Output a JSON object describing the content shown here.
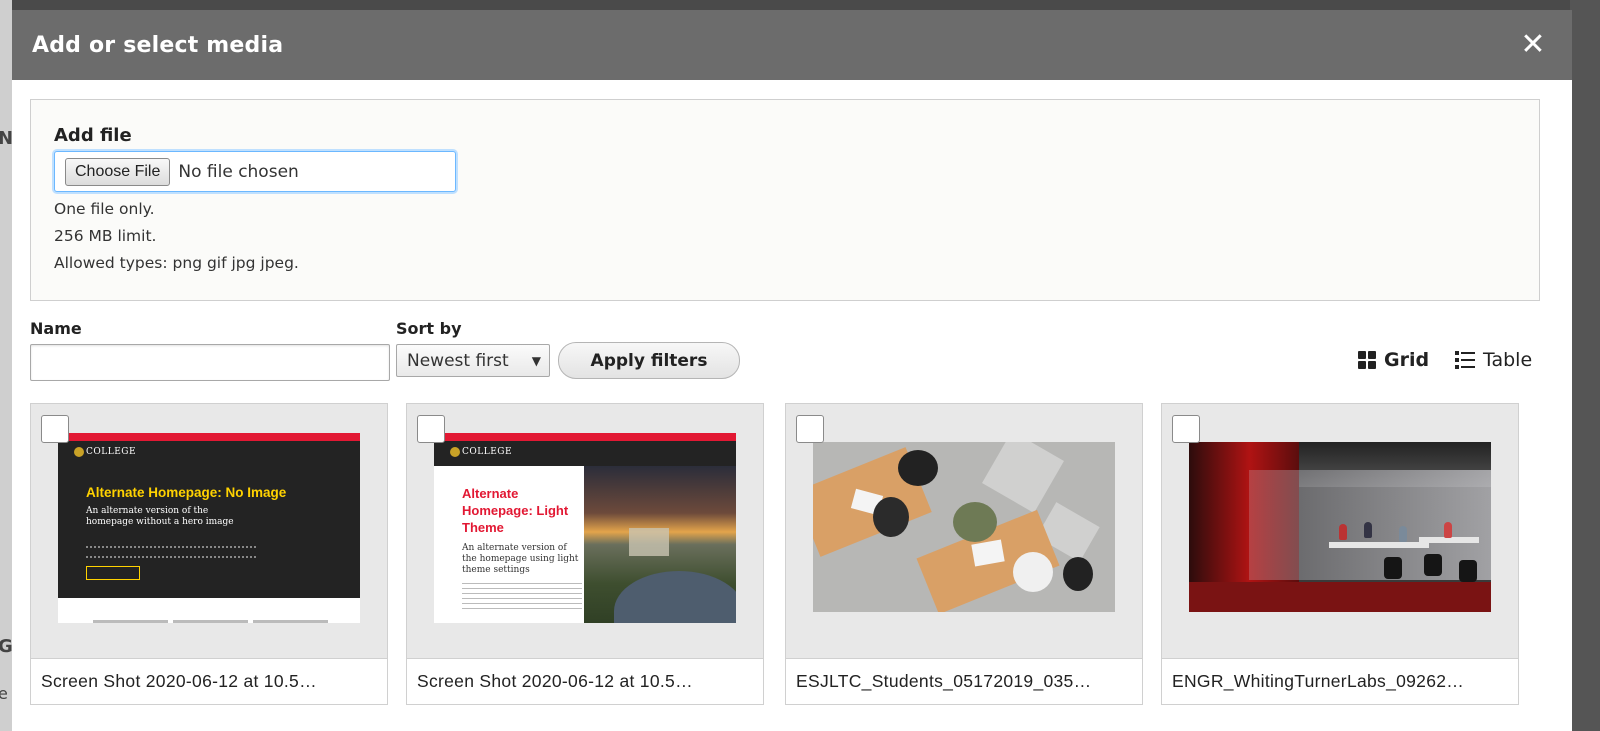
{
  "background": {
    "left_fragment_1": "NT",
    "left_fragment_2": "GI",
    "left_fragment_3": "e"
  },
  "dialog": {
    "title": "Add or select media",
    "close_icon": "close-icon"
  },
  "upload": {
    "label": "Add file",
    "choose_button": "Choose File",
    "file_status": "No file chosen",
    "help": [
      "One file only.",
      "256 MB limit.",
      "Allowed types: png gif jpg jpeg."
    ]
  },
  "filters": {
    "name_label": "Name",
    "name_value": "",
    "sort_label": "Sort by",
    "sort_value": "Newest first",
    "apply_label": "Apply filters"
  },
  "view_toggle": {
    "grid_label": "Grid",
    "table_label": "Table",
    "active": "Grid"
  },
  "media": [
    {
      "caption": "Screen Shot 2020-06-12 at 10.5…",
      "thumb_title": "Alternate Homepage: No Image",
      "thumb_subtitle": "An alternate version of the homepage without a hero image",
      "checked": false
    },
    {
      "caption": "Screen Shot 2020-06-12 at 10.5…",
      "thumb_title": "Alternate Homepage: Light Theme",
      "thumb_subtitle": "An alternate version of the homepage using light theme settings",
      "checked": false
    },
    {
      "caption": "ESJLTC_Students_05172019_035…",
      "checked": false
    },
    {
      "caption": "ENGR_WhitingTurnerLabs_09262…",
      "checked": false
    }
  ],
  "thumb_logo": "COLLEGE",
  "colors": {
    "titlebar": "#6c6c6c",
    "brand_red": "#e21833",
    "brand_gold": "#ffd200",
    "focus_blue": "#6cb8ff"
  }
}
